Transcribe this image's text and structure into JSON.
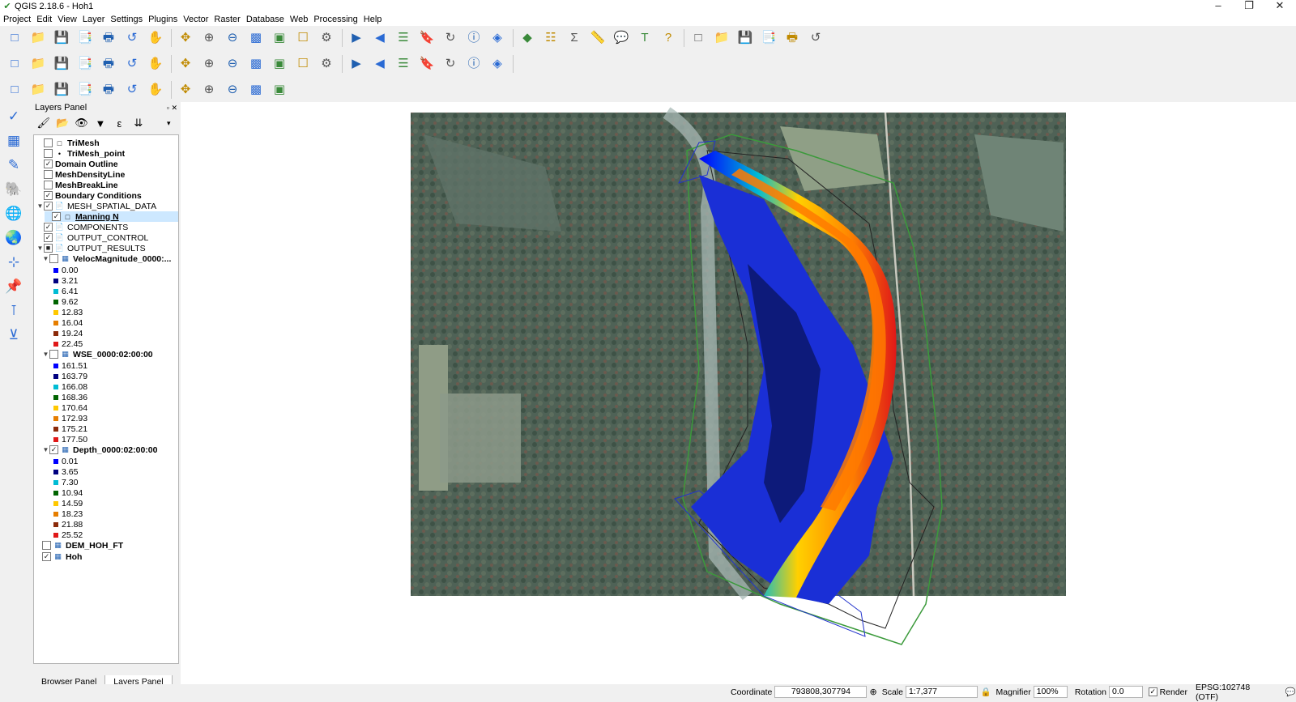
{
  "window": {
    "title": "QGIS 2.18.6 - Hoh1"
  },
  "menu": [
    "Project",
    "Edit",
    "View",
    "Layer",
    "Settings",
    "Plugins",
    "Vector",
    "Raster",
    "Database",
    "Web",
    "Processing",
    "Help"
  ],
  "toolbar1": [
    "new-project",
    "open-project",
    "save-project",
    "save-as",
    "new-print-composer",
    "composer-manager",
    "touch-zoom",
    "pan",
    "pan-to-selection",
    "zoom-in",
    "zoom-out",
    "zoom-native",
    "zoom-full",
    "zoom-to-selection",
    "zoom-to-layer",
    "zoom-last",
    "zoom-next",
    "new-map-view",
    "new-bookmark",
    "show-bookmarks",
    "refresh",
    "identify",
    "action",
    "select-features",
    "select-value",
    "deselect",
    "open-attribute-table",
    "field-calculator",
    "statistics",
    "measure",
    "map-tips",
    "text-annotation",
    "help",
    "python-console"
  ],
  "toolbar2": [
    "toggle-editing",
    "current-edits",
    "save-edits",
    "add-feature",
    "move-feature",
    "node-tool",
    "delete-selected",
    "cut-features",
    "copy-features",
    "paste-features",
    "label-tool",
    "diagram",
    "pin-labels",
    "show-hide-labels",
    "move-label",
    "rotate-label",
    "change-label",
    "style-manager",
    "add-wms",
    "add-wfs",
    "snapping"
  ],
  "toolbar3": [
    "mesh-tool-1",
    "mesh-tool-2",
    "mesh-tool-3",
    "mesh-tool-4",
    "mesh-tool-5",
    "mesh-tool-6",
    "mesh-tool-7",
    "mesh-tool-8",
    "mesh-tool-9",
    "mesh-tool-10",
    "mesh-tool-11",
    "mesh-tool-12"
  ],
  "leftbar": [
    "add-vector",
    "add-raster",
    "add-spatialite",
    "add-postgis",
    "add-wms",
    "add-wcs",
    "add-wfs",
    "new-shapefile",
    "add-virtual",
    "add-delimited"
  ],
  "layersPanel": {
    "title": "Layers Panel",
    "layers": [
      {
        "name": "TriMesh",
        "bold": true,
        "checked": false,
        "icon": "square",
        "indent": 0
      },
      {
        "name": "TriMesh_point",
        "bold": true,
        "checked": false,
        "icon": "dot",
        "indent": 0
      },
      {
        "name": "Domain Outline",
        "bold": true,
        "checked": true,
        "icon": "none",
        "indent": 0
      },
      {
        "name": "MeshDensityLine",
        "bold": true,
        "checked": false,
        "icon": "none",
        "indent": 0
      },
      {
        "name": "MeshBreakLine",
        "bold": true,
        "checked": false,
        "icon": "none",
        "indent": 0
      },
      {
        "name": "Boundary Conditions",
        "bold": true,
        "checked": true,
        "icon": "none",
        "indent": 0
      },
      {
        "name": "MESH_SPATIAL_DATA",
        "bold": false,
        "checked": true,
        "icon": "group",
        "indent": 0,
        "group": true
      },
      {
        "name": "Manning N",
        "bold": true,
        "checked": true,
        "icon": "square",
        "indent": 1,
        "selected": true,
        "underline": true
      },
      {
        "name": "COMPONENTS",
        "bold": false,
        "checked": true,
        "icon": "group",
        "indent": 0
      },
      {
        "name": "OUTPUT_CONTROL",
        "bold": false,
        "checked": true,
        "icon": "group",
        "indent": 0
      },
      {
        "name": "OUTPUT_RESULTS",
        "bold": false,
        "checked": true,
        "icon": "group",
        "indent": 0,
        "group": true,
        "partial": true
      }
    ],
    "rasters": [
      {
        "name": "VelocMagnitude_0000:...",
        "checked": false,
        "values": [
          "0.00",
          "3.21",
          "6.41",
          "9.62",
          "12.83",
          "16.04",
          "19.24",
          "22.45"
        ]
      },
      {
        "name": "WSE_0000:02:00:00",
        "checked": false,
        "values": [
          "161.51",
          "163.79",
          "166.08",
          "168.36",
          "170.64",
          "172.93",
          "175.21",
          "177.50"
        ]
      },
      {
        "name": "Depth_0000:02:00:00",
        "checked": true,
        "values": [
          "0.01",
          "3.65",
          "7.30",
          "10.94",
          "14.59",
          "18.23",
          "21.88",
          "25.52"
        ]
      }
    ],
    "bottomLayers": [
      {
        "name": "DEM_HOH_FT",
        "checked": false
      },
      {
        "name": "Hoh",
        "checked": true
      }
    ],
    "rampColors": [
      "#0000ff",
      "#000080",
      "#00bcd4",
      "#006400",
      "#ffc800",
      "#e67e00",
      "#8b2a0a",
      "#e01818"
    ]
  },
  "tabs": {
    "browser": "Browser Panel",
    "layers": "Layers Panel"
  },
  "status": {
    "coordinateLabel": "Coordinate",
    "coordinate": "793808,307794",
    "scaleLabel": "Scale",
    "scale": "1:7,377",
    "magnifierLabel": "Magnifier",
    "magnifier": "100%",
    "rotationLabel": "Rotation",
    "rotation": "0.0",
    "renderLabel": "Render",
    "crs": "EPSG:102748 (OTF)"
  }
}
